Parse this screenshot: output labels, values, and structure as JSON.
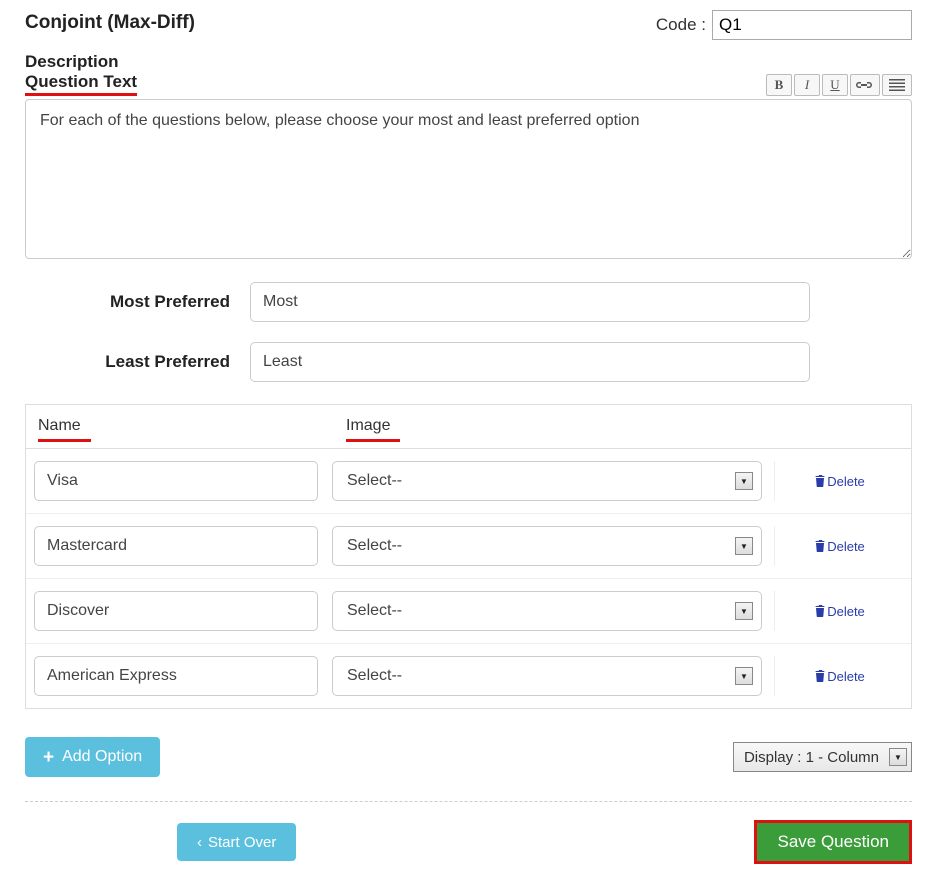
{
  "header": {
    "question_type": "Conjoint (Max-Diff)",
    "code_label": "Code :",
    "code_value": "Q1"
  },
  "description_heading": "Description",
  "question_text_heading": "Question Text",
  "question_text_value": "For each of the questions below, please choose your most and least preferred option",
  "preferred": {
    "most_label": "Most Preferred",
    "most_value": "Most",
    "least_label": "Least Preferred",
    "least_value": "Least"
  },
  "columns": {
    "name": "Name",
    "image": "Image"
  },
  "options": [
    {
      "name": "Visa",
      "image_selected": "Select--"
    },
    {
      "name": "Mastercard",
      "image_selected": "Select--"
    },
    {
      "name": "Discover",
      "image_selected": "Select--"
    },
    {
      "name": "American Express",
      "image_selected": "Select--"
    }
  ],
  "delete_label": "Delete",
  "add_option_label": "Add Option",
  "display_select_value": "Display : 1 - Column",
  "footer": {
    "start_over": "Start Over",
    "save": "Save Question"
  }
}
